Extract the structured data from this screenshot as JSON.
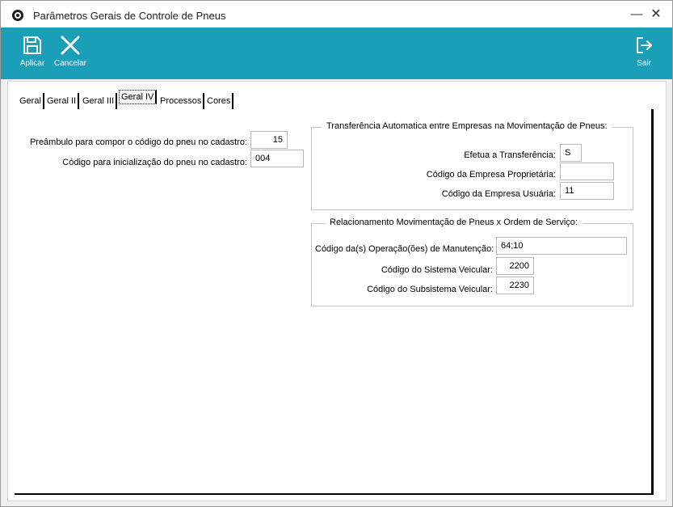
{
  "window": {
    "title": "Parâmetros Gerais de Controle de Pneus"
  },
  "toolbar": {
    "apply_label": "Aplicar",
    "cancel_label": "Cancelar",
    "exit_label": "Sair"
  },
  "tabs": [
    {
      "label": "Geral"
    },
    {
      "label": "Geral II"
    },
    {
      "label": "Geral III"
    },
    {
      "label": "Geral IV"
    },
    {
      "label": "Processos"
    },
    {
      "label": "Cores"
    }
  ],
  "left_fields": {
    "preamble_label": "Preâmbulo para compor o código do pneu no cadastro:",
    "preamble_value": "15",
    "init_label": "Código para inicialização do pneu no cadastro:",
    "init_value": "004"
  },
  "transfer_group": {
    "title": "Transferência Automatica entre Empresas na Movimentação de Pneus:",
    "effect_label": "Efetua a Transferência:",
    "effect_value": "S",
    "owner_label": "Código da Empresa Proprietária:",
    "owner_value": "",
    "user_label": "Código da Empresa Usuária:",
    "user_value": "11"
  },
  "service_group": {
    "title": "Relacionamento Movimentação de Pneus x Ordem de Serviço:",
    "ops_label": "Código da(s) Operação(ões) de Manutenção:",
    "ops_value": "64;10",
    "system_label": "Código do Sistema Veicular:",
    "system_value": "2200",
    "subsystem_label": "Código do Subsistema Veicular:",
    "subsystem_value": "2230"
  }
}
